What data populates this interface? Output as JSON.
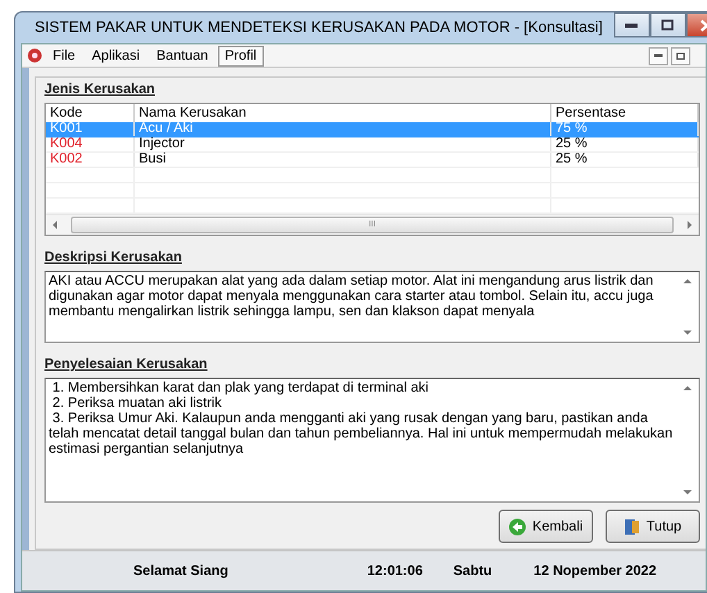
{
  "window": {
    "title": "SISTEM  PAKAR UNTUK MENDETEKSI KERUSAKAN PADA MOTOR - [Konsultasi]"
  },
  "menu": [
    {
      "label": "File",
      "selected": false
    },
    {
      "label": "Aplikasi",
      "selected": false
    },
    {
      "label": "Bantuan",
      "selected": false
    },
    {
      "label": "Profil",
      "selected": true
    }
  ],
  "damage_types": {
    "heading": "Jenis Kerusakan",
    "columns": [
      "Kode",
      "Nama Kerusakan",
      "Persentase"
    ],
    "rows": [
      {
        "code": "K001",
        "name": "Acu / Aki",
        "percent": "75 %",
        "selected": true
      },
      {
        "code": "K004",
        "name": "Injector",
        "percent": "25 %",
        "selected": false
      },
      {
        "code": "K002",
        "name": "Busi",
        "percent": "25 %",
        "selected": false
      }
    ],
    "scroll_thumb": "III"
  },
  "description": {
    "heading": "Deskripsi Kerusakan",
    "text": "AKI atau  ACCU merupakan alat yang ada dalam setiap motor. Alat ini mengandung arus listrik dan digunakan agar motor dapat menyala menggunakan cara starter atau tombol. Selain itu, accu juga membantu mengalirkan listrik sehingga lampu, sen dan klakson dapat menyala"
  },
  "solution": {
    "heading": "Penyelesaian Kerusakan",
    "lines": [
      "1. Membersihkan karat dan plak yang terdapat di terminal aki",
      "2. Periksa muatan aki listrik",
      "3. Periksa Umur Aki. Kalaupun anda mengganti aki yang rusak dengan yang baru, pastikan anda telah mencatat detail tanggal bulan dan tahun pembeliannya. Hal ini untuk mempermudah melakukan estimasi pergantian selanjutnya"
    ]
  },
  "buttons": [
    {
      "kind": "back",
      "label": "Kembali"
    },
    {
      "kind": "close",
      "label": "Tutup"
    }
  ],
  "status_bar": {
    "greeting": "Selamat Siang",
    "time": "12:01:06",
    "day": "Sabtu",
    "date": "12 Nopember 2022"
  }
}
